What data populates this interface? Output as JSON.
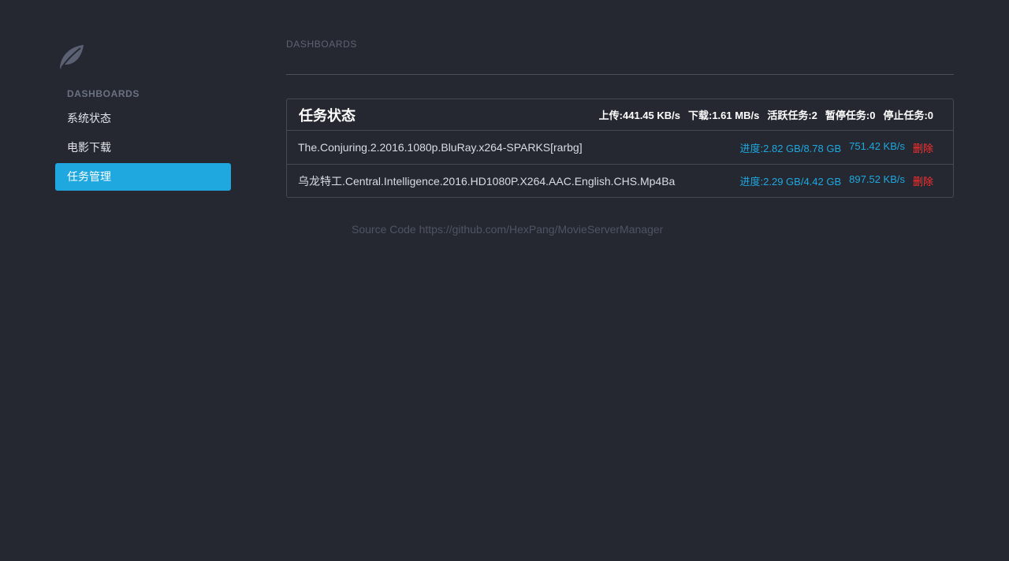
{
  "sidebar": {
    "logo_icon": "leaf-icon",
    "section_label": "DASHBOARDS",
    "items": [
      {
        "label": "系统状态",
        "active": false
      },
      {
        "label": "电影下载",
        "active": false
      },
      {
        "label": "任务管理",
        "active": true
      }
    ]
  },
  "header": {
    "breadcrumb": "DASHBOARDS"
  },
  "panel": {
    "title": "任务状态",
    "stats": {
      "upload": "上传:441.45 KB/s",
      "download": "下载:1.61 MB/s",
      "active": "活跃任务:2",
      "paused": "暂停任务:0",
      "stopped": "停止任务:0"
    },
    "tasks": [
      {
        "name": "The.Conjuring.2.2016.1080p.BluRay.x264-SPARKS[rarbg]",
        "progress": "进度:2.82 GB/8.78 GB",
        "speed": "751.42 KB/s",
        "delete_label": "删除"
      },
      {
        "name": "乌龙特工.Central.Intelligence.2016.HD1080P.X264.AAC.English.CHS.Mp4Ba",
        "progress": "进度:2.29 GB/4.42 GB",
        "speed": "897.52 KB/s",
        "delete_label": "删除"
      }
    ]
  },
  "footer": {
    "text": "Source Code https://github.com/HexPang/MovieServerManager"
  },
  "colors": {
    "background": "#252831",
    "accent": "#1ea8df",
    "danger": "#ff2f2f"
  }
}
